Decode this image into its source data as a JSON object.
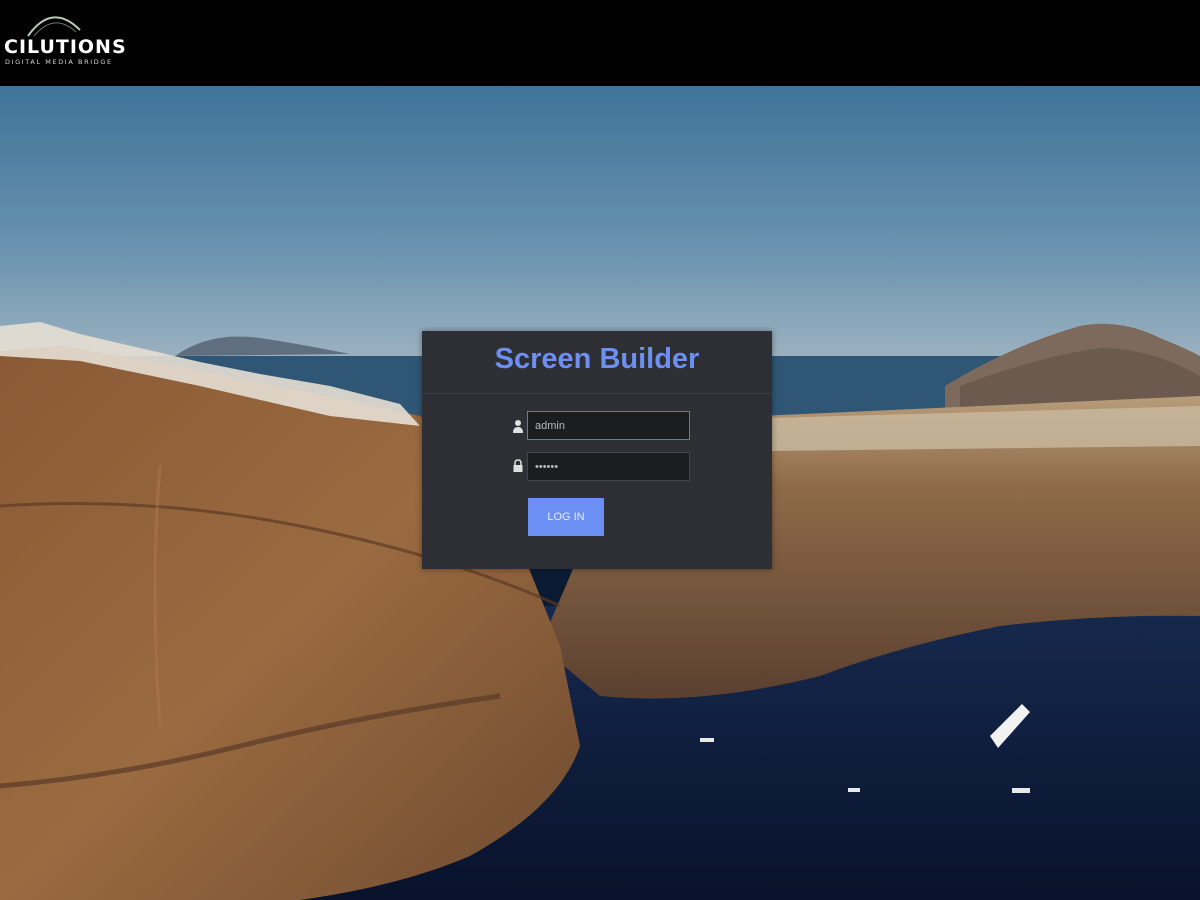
{
  "header": {
    "logo": {
      "name": "CILUTIONS",
      "tagline": "DIGITAL MEDIA BRIDGE",
      "icon": "arc-logo-icon"
    }
  },
  "background": {
    "description_icon": "coastal-cliff-photo"
  },
  "login": {
    "title": "Screen Builder",
    "username": {
      "icon": "user-icon",
      "value": "admin"
    },
    "password": {
      "icon": "lock-icon",
      "value": "••••••"
    },
    "button_label": "LOG IN"
  },
  "colors": {
    "header_bg": "#000000",
    "panel_bg": "#2e2f35",
    "title_accent": "#6d8ff0",
    "button_bg": "#6b8ff2",
    "focus_border": "#5d8f3c"
  }
}
